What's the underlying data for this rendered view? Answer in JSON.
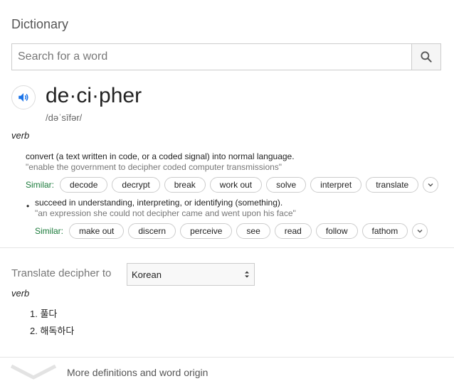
{
  "header": {
    "title": "Dictionary"
  },
  "search": {
    "placeholder": "Search for a word",
    "value": ""
  },
  "entry": {
    "word": "de·ci·pher",
    "phonetic": "/dəˈsīfər/",
    "part_of_speech": "verb",
    "senses": [
      {
        "definition": "convert (a text written in code, or a coded signal) into normal language.",
        "example": "\"enable the government to decipher coded computer transmissions\"",
        "similar_label": "Similar:",
        "similar": [
          "decode",
          "decrypt",
          "break",
          "work out",
          "solve",
          "interpret",
          "translate"
        ]
      },
      {
        "definition": "succeed in understanding, interpreting, or identifying (something).",
        "example": "\"an expression she could not decipher came and went upon his face\"",
        "similar_label": "Similar:",
        "similar": [
          "make out",
          "discern",
          "perceive",
          "see",
          "read",
          "follow",
          "fathom"
        ]
      }
    ]
  },
  "translate": {
    "label": "Translate decipher to",
    "selected_language": "Korean",
    "part_of_speech": "verb",
    "items": [
      "1. 풀다",
      "2. 해독하다"
    ]
  },
  "footer": {
    "more_label": "More definitions and word origin"
  },
  "colors": {
    "similar_green": "#1a7a3a",
    "accent_blue": "#1a73e8"
  },
  "icons": {
    "search": "search-icon",
    "audio": "speaker-icon",
    "expand": "chevron-down-icon"
  }
}
